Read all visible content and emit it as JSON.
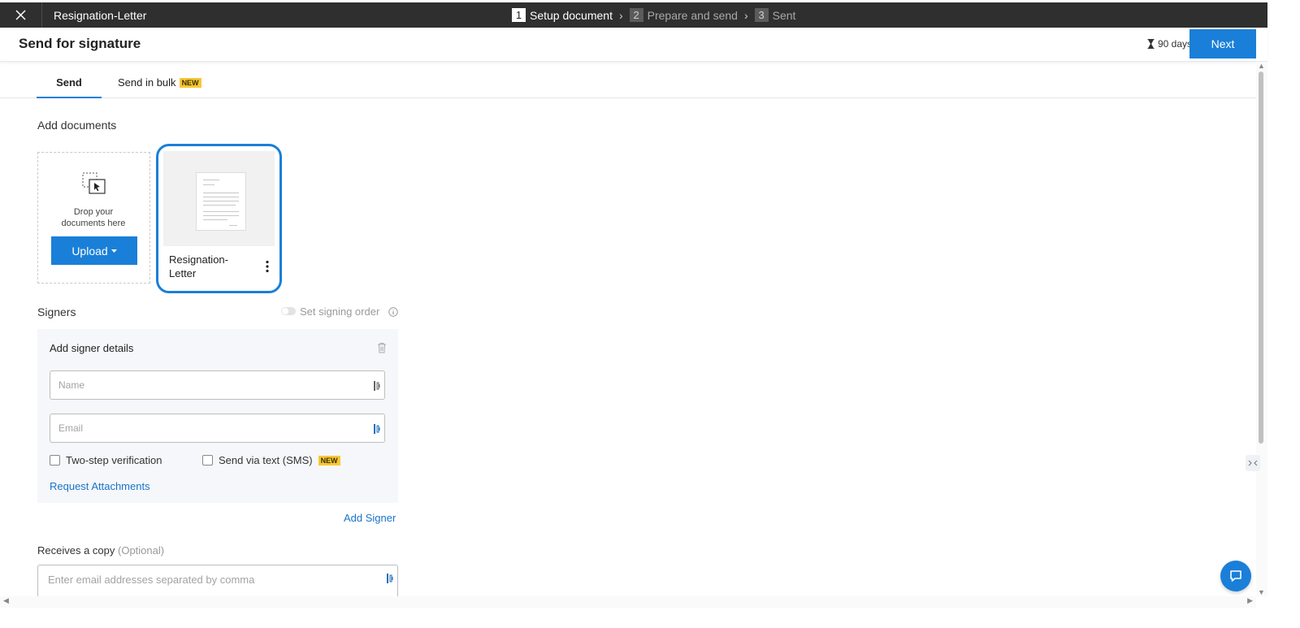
{
  "topbar": {
    "document_title": "Resignation-Letter",
    "steps": [
      {
        "number": "1",
        "label": "Setup document",
        "state": "active"
      },
      {
        "number": "2",
        "label": "Prepare and send",
        "state": "inactive"
      },
      {
        "number": "3",
        "label": "Sent",
        "state": "inactive"
      }
    ],
    "separator": "›"
  },
  "header": {
    "title": "Send for signature",
    "expiry": "90 days",
    "next_label": "Next"
  },
  "tabs": {
    "send": "Send",
    "bulk": "Send in bulk",
    "bulk_badge": "NEW"
  },
  "documents": {
    "heading": "Add documents",
    "drop_text_line1": "Drop your",
    "drop_text_line2": "documents here",
    "upload_label": "Upload",
    "items": [
      {
        "name_line1": "Resignation-",
        "name_line2": "Letter"
      }
    ]
  },
  "signers": {
    "heading": "Signers",
    "signing_order_label": "Set signing order",
    "box_title": "Add signer details",
    "name_placeholder": "Name",
    "email_placeholder": "Email",
    "two_step_label": "Two-step verification",
    "sms_label": "Send via text (SMS)",
    "sms_badge": "NEW",
    "request_attachments": "Request Attachments",
    "add_signer": "Add Signer"
  },
  "copy": {
    "heading": "Receives a copy",
    "optional": "(Optional)",
    "placeholder": "Enter email addresses separated by comma"
  },
  "colors": {
    "accent": "#1a7fd8",
    "topbar_bg": "#2f2f2f",
    "badge": "#f7c836",
    "link": "#1a73c9"
  },
  "icons": [
    "close-icon",
    "hourglass-icon",
    "drop-files-icon",
    "caret-down-icon",
    "kebab-menu-icon",
    "info-icon",
    "trash-icon",
    "contact-book-icon",
    "chat-icon"
  ]
}
